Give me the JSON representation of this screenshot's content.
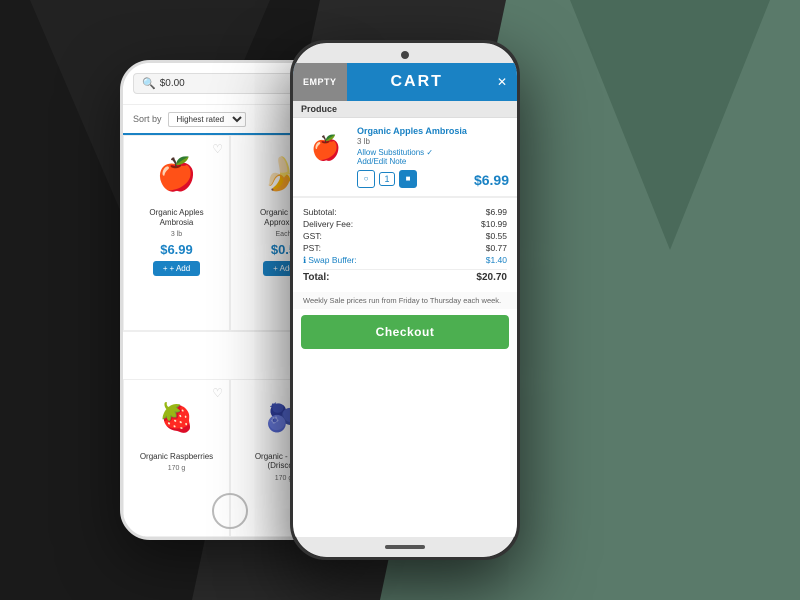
{
  "background": {
    "left_color": "#1a1a1a",
    "right_color": "#5a7a6a"
  },
  "phone_back": {
    "search": {
      "amount": "$0.00",
      "placeholder": "Search"
    },
    "sort": {
      "label": "Sort by",
      "value": "Highest rated"
    },
    "products": [
      {
        "name": "Organic Apples Ambrosia",
        "weight": "3 lb",
        "price": "$6.99",
        "emoji": "🍎",
        "add_label": "+ Add"
      },
      {
        "name": "Organic - B...",
        "weight": "Approx 2...",
        "price": "$0.5",
        "emoji": "🍌",
        "add_label": "+ Add"
      },
      {
        "name": "Organic Raspberries",
        "weight": "170 g",
        "price": "",
        "emoji": "🫐",
        "add_label": ""
      },
      {
        "name": "Organic - Blac...",
        "weight": "170 g",
        "price": "",
        "emoji": "🫐",
        "add_label": ""
      }
    ]
  },
  "cart_modal": {
    "empty_label": "EMPTY",
    "title": "CART",
    "close_label": "✕",
    "section_label": "Produce",
    "item": {
      "name": "Organic Apples Ambrosia",
      "weight": "3 lb",
      "substitutions": "Allow Substitutions ✓",
      "note": "Add/Edit Note",
      "qty": "1",
      "price": "$6.99",
      "emoji": "🍎"
    },
    "summary": {
      "subtotal_label": "Subtotal:",
      "subtotal_value": "$6.99",
      "delivery_label": "Delivery Fee:",
      "delivery_value": "$10.99",
      "gst_label": "GST:",
      "gst_value": "$0.55",
      "pst_label": "PST:",
      "pst_value": "$0.77",
      "swap_label": "Swap Buffer:",
      "swap_value": "$1.40",
      "total_label": "Total:",
      "total_value": "$20.70"
    },
    "notice": "Weekly Sale prices run from Friday to Thursday each week.",
    "checkout_label": "Checkout"
  },
  "front_bottom_products": [
    {
      "name": "Organic Raspberries\n170 g",
      "emoji": "🫐"
    },
    {
      "name": "Organic - Blackberries (Driscolls)\n170 g",
      "emoji": "⬛"
    }
  ]
}
